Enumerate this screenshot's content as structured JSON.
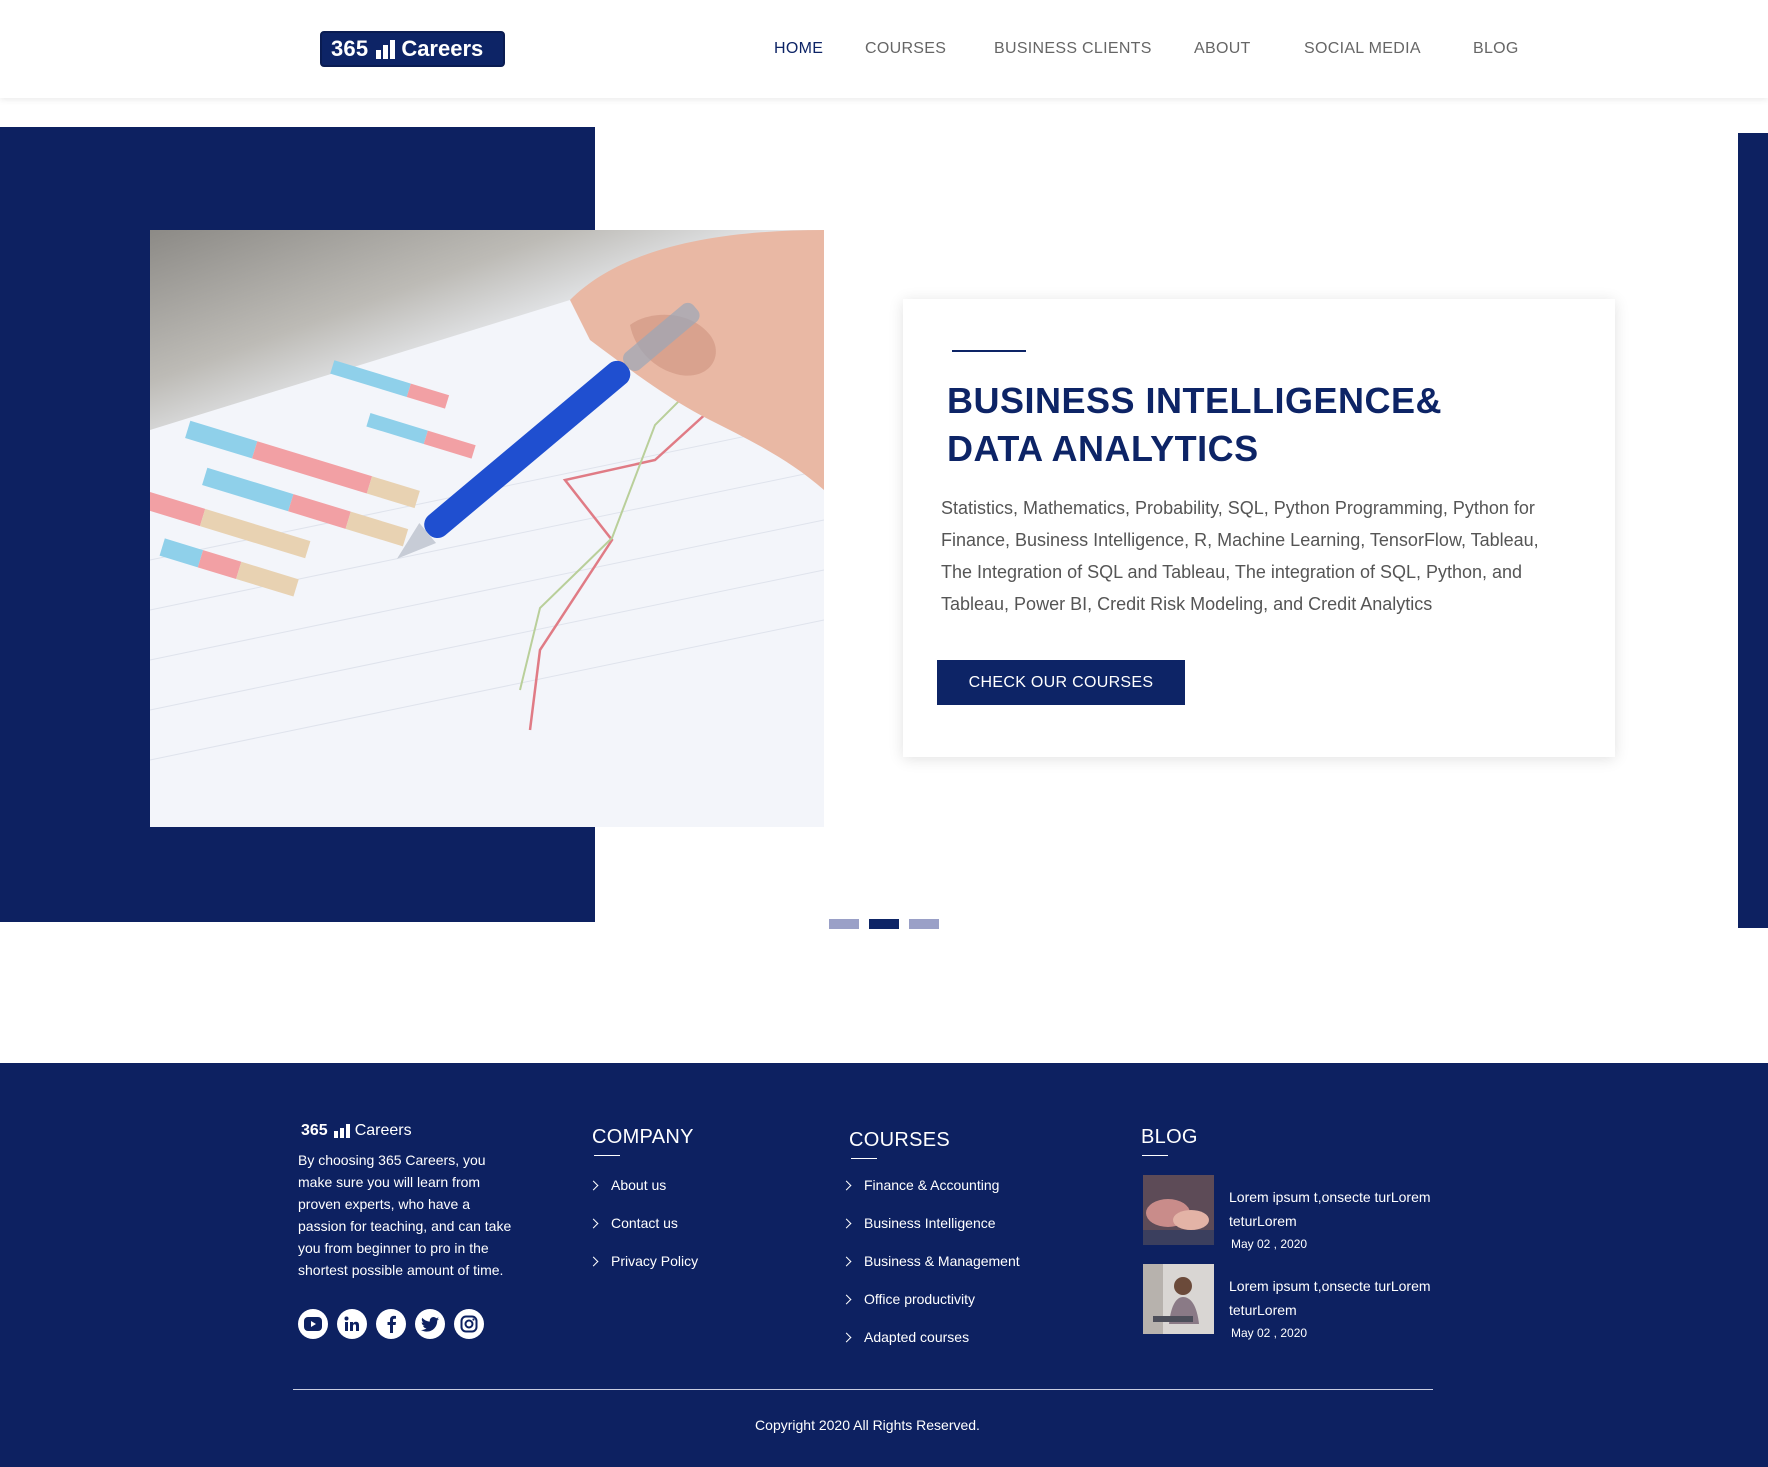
{
  "header": {
    "logo": {
      "number": "365",
      "word": "Careers"
    },
    "nav": [
      {
        "label": "HOME",
        "active": true
      },
      {
        "label": "COURSES",
        "active": false
      },
      {
        "label": "BUSINESS CLIENTS",
        "active": false
      },
      {
        "label": "ABOUT",
        "active": false
      },
      {
        "label": "SOCIAL MEDIA",
        "active": false
      },
      {
        "label": "BLOG",
        "active": false
      }
    ]
  },
  "hero": {
    "title_line1": "BUSINESS INTELLIGENCE&",
    "title_line2": "DATA ANALYTICS",
    "description": "Statistics, Mathematics, Probability, SQL, Python Programming, Python for Finance, Business Intelligence, R, Machine Learning, TensorFlow, Tableau, The Integration of SQL and Tableau, The integration of SQL, Python, and Tableau, Power BI, Credit Risk Modeling, and Credit Analytics",
    "cta_label": "CHECK OUR COURSES",
    "slides": {
      "count": 3,
      "active": 2
    }
  },
  "footer": {
    "logo": {
      "number": "365",
      "word": "Careers"
    },
    "about": "By choosing 365 Careers, you make sure you will learn from proven experts, who have a passion for teaching, and can take you from beginner to pro in the shortest possible amount of time.",
    "socials": [
      "youtube-icon",
      "linkedin-icon",
      "facebook-icon",
      "twitter-icon",
      "instagram-icon"
    ],
    "company": {
      "heading": "COMPANY",
      "links": [
        "About us",
        "Contact  us",
        "Privacy Policy"
      ]
    },
    "courses": {
      "heading": "COURSES",
      "links": [
        "Finance & Accounting",
        "Business Intelligence",
        "Business & Management",
        "Office productivity",
        "Adapted courses"
      ]
    },
    "blog": {
      "heading": "BLOG",
      "posts": [
        {
          "title": "Lorem ipsum t,onsecte turLorem teturLorem",
          "date": "May 02 , 2020"
        },
        {
          "title": "Lorem ipsum t,onsecte turLorem teturLorem",
          "date": "May 02 , 2020"
        }
      ]
    },
    "copyright": "Copyright 2020 All Rights Reserved."
  },
  "colors": {
    "brand_navy": "#0d2161",
    "text_gray": "#555555",
    "dot_inactive": "#9aa0c7"
  }
}
